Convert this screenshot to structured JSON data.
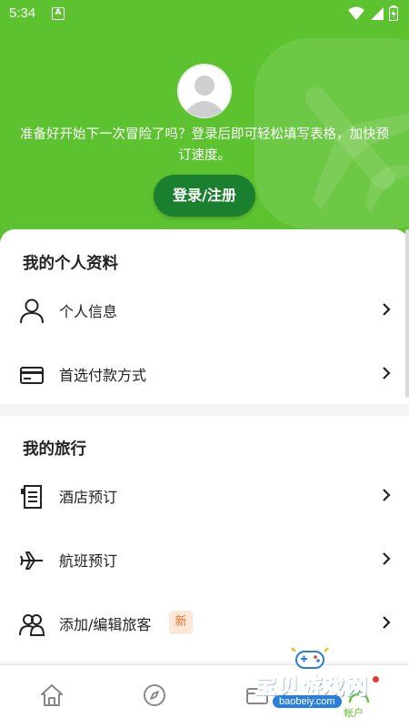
{
  "status_bar": {
    "time": "5:34",
    "app_icon_letter": "A"
  },
  "header": {
    "welcome_text": "准备好开始下一次冒险了吗？登录后即可轻松填写表格，加快预订速度。",
    "login_button": "登录/注册",
    "background_color": "#5cc230",
    "button_color": "#1a7f2e"
  },
  "profile_section": {
    "title": "我的个人资料",
    "items": [
      {
        "label": "个人信息",
        "icon": "person-icon"
      },
      {
        "label": "首选付款方式",
        "icon": "credit-card-icon"
      }
    ]
  },
  "trips_section": {
    "title": "我的旅行",
    "items": [
      {
        "label": "酒店预订",
        "icon": "hotel-receipt-icon"
      },
      {
        "label": "航班预订",
        "icon": "airplane-icon"
      },
      {
        "label": "添加/编辑旅客",
        "icon": "travelers-icon",
        "badge": "新"
      }
    ]
  },
  "bottom_nav": {
    "items": [
      {
        "icon": "home-icon"
      },
      {
        "icon": "compass-icon"
      },
      {
        "icon": "trips-card-icon"
      },
      {
        "icon": "account-icon",
        "label": "帐户",
        "active": true
      }
    ],
    "active_color": "#5cc230"
  },
  "watermark": {
    "text": "宝贝游戏网",
    "url": "baobeiy.com"
  }
}
